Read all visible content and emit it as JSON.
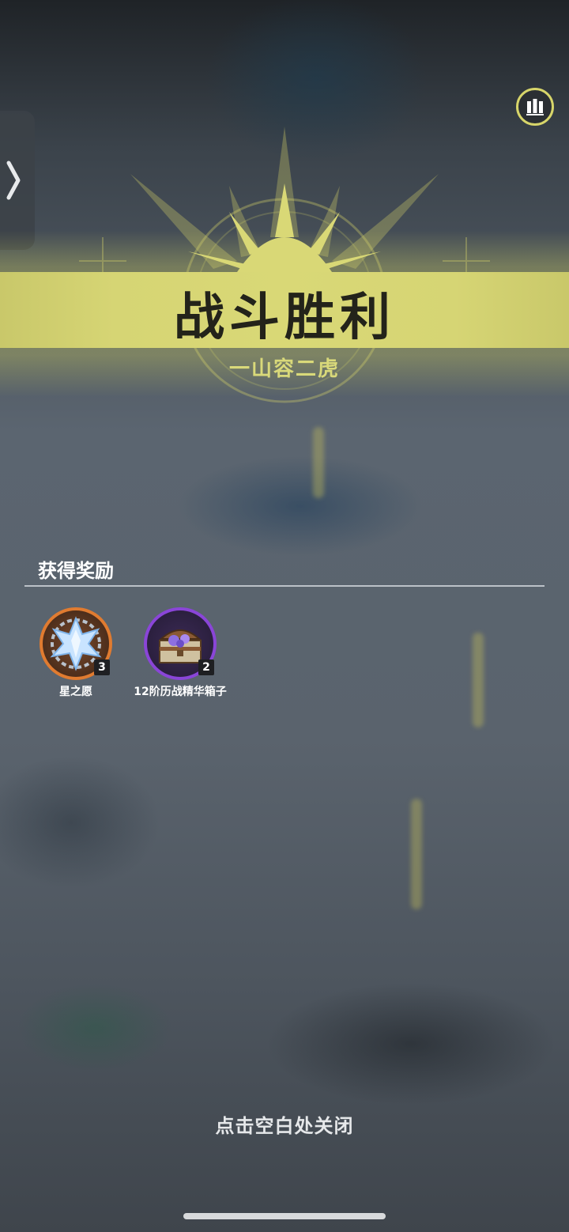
{
  "banner": {
    "title": "战斗胜利",
    "subtitle": "一山容二虎"
  },
  "rewards": {
    "heading": "获得奖励",
    "items": [
      {
        "label": "星之愿",
        "count": "3",
        "icon": "star-crystal-icon",
        "ring_color": "#e07b30"
      },
      {
        "label": "12阶历战精华箱子",
        "count": "2",
        "icon": "treasure-chest-icon",
        "ring_color": "#8a45d8"
      }
    ]
  },
  "footer": {
    "close_hint": "点击空白处关闭"
  },
  "colors": {
    "accent": "#d7d56a",
    "banner": "#d9d876",
    "title_text": "#23231a"
  }
}
